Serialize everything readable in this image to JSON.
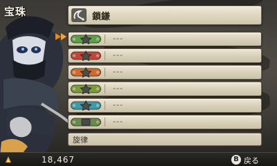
{
  "header": {
    "label": "宝珠"
  },
  "weapon": {
    "name": "鎖鎌",
    "icon": "kusarigama-icon"
  },
  "slots": [
    {
      "value": "---",
      "jewel_color": "#5e9e48",
      "selected": true
    },
    {
      "value": "---",
      "jewel_color": "#c2473a",
      "selected": false
    },
    {
      "value": "---",
      "jewel_color": "#d06a2e",
      "selected": false
    },
    {
      "value": "---",
      "jewel_color": "#7a9a3c",
      "selected": false
    },
    {
      "value": "---",
      "jewel_color": "#3f9aa8",
      "selected": false
    },
    {
      "value": "---",
      "jewel_color": "#6a8a4a",
      "selected": false
    }
  ],
  "melody": {
    "label": "旋律"
  },
  "footer": {
    "money": "18,467",
    "button": "B",
    "back_label": "戻る"
  },
  "colors": {
    "panel": "#e6dfca",
    "frame": "#6f6656",
    "accent_arrow": "#e58a1f"
  }
}
